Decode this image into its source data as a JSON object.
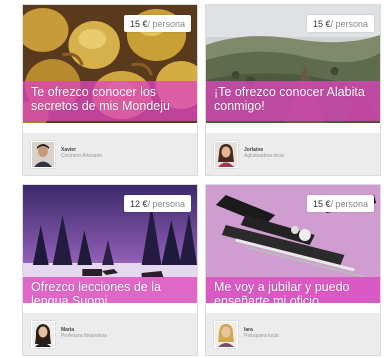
{
  "cards": [
    {
      "price_amount": "15 €",
      "price_unit": "/ persona",
      "headline": "Te ofrezco conocer los secretos de mis Mondeju",
      "person_name": "Xavier",
      "person_role": "Cocinero Artesano",
      "colors": {
        "headline_bg": "#dc46be"
      }
    },
    {
      "price_amount": "15 €",
      "price_unit": "/ persona",
      "headline": "¡Te ofrezco conocer Alabita conmigo!",
      "person_name": "Jorlaine",
      "person_role": "Aglutinadora local",
      "colors": {
        "headline_bg": "#dc46be"
      }
    },
    {
      "price_amount": "12 €",
      "price_unit": "/ persona",
      "headline": "Ofrezco lecciones de la lengua Suomi",
      "person_name": "Maria",
      "person_role": "Profesora finlandesa",
      "colors": {
        "headline_bg": "#dc46be"
      }
    },
    {
      "price_amount": "15 €",
      "price_unit": "/ persona",
      "headline": "Me voy a jubilar y puedo enseñarte mi oficio",
      "person_name": "Iara",
      "person_role": "Peluquera local",
      "colors": {
        "headline_bg": "#dc46be"
      }
    }
  ]
}
